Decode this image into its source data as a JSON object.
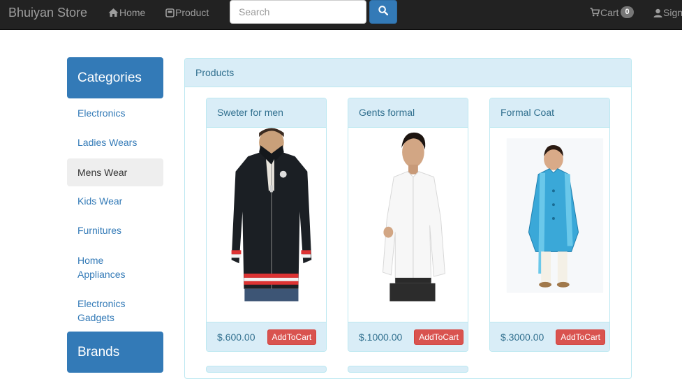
{
  "navbar": {
    "brand": "Bhuiyan Store",
    "home_label": "Home",
    "product_label": "Product",
    "search_placeholder": "Search",
    "cart_label": "Cart",
    "cart_count": "0",
    "sign_label": "Sign"
  },
  "sidebar": {
    "categories_title": "Categories",
    "items": [
      {
        "label": "Electronics"
      },
      {
        "label": "Ladies Wears"
      },
      {
        "label": "Mens Wear"
      },
      {
        "label": "Kids Wear"
      },
      {
        "label": "Furnitures"
      },
      {
        "label": "Home Appliances"
      },
      {
        "label": "Electronics Gadgets"
      }
    ],
    "active_item": "Mens Wear",
    "brands_title": "Brands"
  },
  "products_panel": {
    "title": "Products",
    "items": [
      {
        "name": "Sweter for men",
        "price": "$.600.00",
        "button": "AddToCart"
      },
      {
        "name": "Gents formal",
        "price": "$.1000.00",
        "button": "AddToCart"
      },
      {
        "name": "Formal Coat",
        "price": "$.3000.00",
        "button": "AddToCart"
      }
    ]
  },
  "colors": {
    "navbar": "#222222",
    "primary": "#337ab7",
    "info_bg": "#d9edf7",
    "info_border": "#bce8f1",
    "danger": "#d9534f"
  },
  "icons": {
    "home": "home-icon",
    "product": "product-icon",
    "search": "search-icon",
    "cart": "cart-icon",
    "user": "user-icon"
  }
}
